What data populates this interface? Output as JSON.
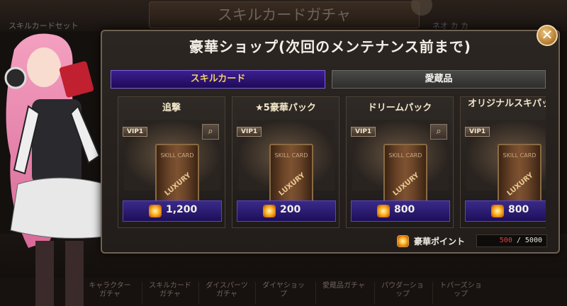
{
  "background": {
    "title": "スキルカードガチャ",
    "subtitle_left": "スキルカードセット",
    "subtitle_right": "ネオ カ カ",
    "tabs": [
      {
        "line1": "キャラクター",
        "line2": "ガチャ"
      },
      {
        "line1": "スキルカード",
        "line2": "ガチャ"
      },
      {
        "line1": "ダイスパーツ",
        "line2": "ガチャ"
      },
      {
        "line1": "ダイヤショッ",
        "line2": "プ"
      },
      {
        "line1": "愛蔵品ガチャ",
        "line2": ""
      },
      {
        "line1": "パウダーショ",
        "line2": "ップ"
      },
      {
        "line1": "トパーズショ",
        "line2": "ップ"
      }
    ]
  },
  "modal": {
    "title": "豪華ショップ(次回のメンテナンス前まで)",
    "close_icon": "close-x",
    "tabs": {
      "active": "スキルカード",
      "inactive": "愛蔵品"
    },
    "cards": [
      {
        "name": "追撃",
        "vip": "VIP1",
        "pack_label": "SKILL CARD",
        "pack_tag": "LUXURY",
        "has_search": true,
        "price": "1,200"
      },
      {
        "name": "★5豪華パック",
        "vip": "VIP1",
        "pack_label": "SKILL CARD",
        "pack_tag": "LUXURY",
        "has_search": false,
        "price": "200"
      },
      {
        "name": "ドリームパック",
        "vip": "VIP1",
        "pack_label": "SKILL CARD",
        "pack_tag": "LUXURY",
        "has_search": true,
        "price": "800"
      },
      {
        "name": "オリジナルスキパック",
        "vip": "VIP1",
        "pack_label": "SKILL CARD",
        "pack_tag": "LUXURY",
        "has_search": false,
        "price": "800"
      }
    ],
    "points": {
      "label": "豪華ポイント",
      "current": "500",
      "sep": " / ",
      "max": "5000"
    }
  },
  "colors": {
    "accent_gold": "#f0d060",
    "price_purple": "#2c1c74",
    "points_red": "#e04040"
  },
  "icons": {
    "search": "magnifier-icon",
    "currency": "gem-icon",
    "close": "close-icon"
  }
}
